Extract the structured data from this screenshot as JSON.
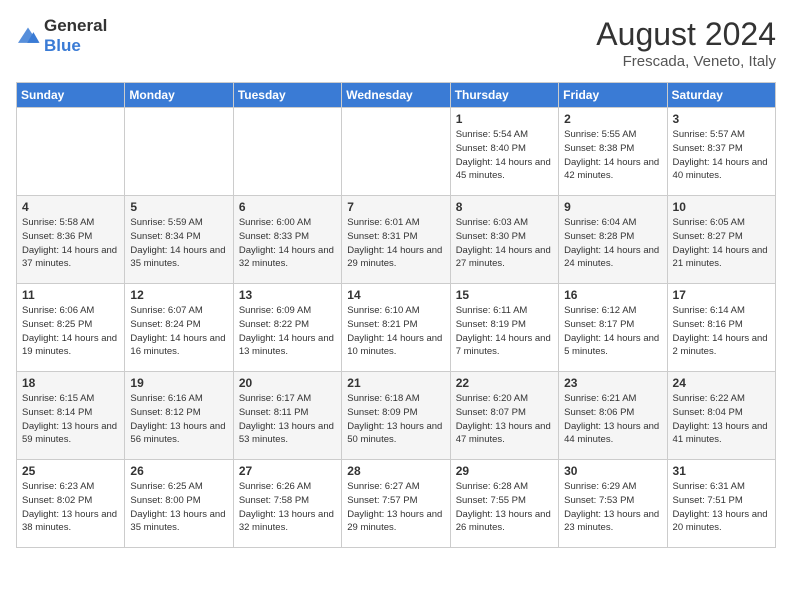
{
  "logo": {
    "general": "General",
    "blue": "Blue"
  },
  "title": {
    "month_year": "August 2024",
    "location": "Frescada, Veneto, Italy"
  },
  "days_of_week": [
    "Sunday",
    "Monday",
    "Tuesday",
    "Wednesday",
    "Thursday",
    "Friday",
    "Saturday"
  ],
  "weeks": [
    [
      {
        "day": "",
        "info": ""
      },
      {
        "day": "",
        "info": ""
      },
      {
        "day": "",
        "info": ""
      },
      {
        "day": "",
        "info": ""
      },
      {
        "day": "1",
        "info": "Sunrise: 5:54 AM\nSunset: 8:40 PM\nDaylight: 14 hours\nand 45 minutes."
      },
      {
        "day": "2",
        "info": "Sunrise: 5:55 AM\nSunset: 8:38 PM\nDaylight: 14 hours\nand 42 minutes."
      },
      {
        "day": "3",
        "info": "Sunrise: 5:57 AM\nSunset: 8:37 PM\nDaylight: 14 hours\nand 40 minutes."
      }
    ],
    [
      {
        "day": "4",
        "info": "Sunrise: 5:58 AM\nSunset: 8:36 PM\nDaylight: 14 hours\nand 37 minutes."
      },
      {
        "day": "5",
        "info": "Sunrise: 5:59 AM\nSunset: 8:34 PM\nDaylight: 14 hours\nand 35 minutes."
      },
      {
        "day": "6",
        "info": "Sunrise: 6:00 AM\nSunset: 8:33 PM\nDaylight: 14 hours\nand 32 minutes."
      },
      {
        "day": "7",
        "info": "Sunrise: 6:01 AM\nSunset: 8:31 PM\nDaylight: 14 hours\nand 29 minutes."
      },
      {
        "day": "8",
        "info": "Sunrise: 6:03 AM\nSunset: 8:30 PM\nDaylight: 14 hours\nand 27 minutes."
      },
      {
        "day": "9",
        "info": "Sunrise: 6:04 AM\nSunset: 8:28 PM\nDaylight: 14 hours\nand 24 minutes."
      },
      {
        "day": "10",
        "info": "Sunrise: 6:05 AM\nSunset: 8:27 PM\nDaylight: 14 hours\nand 21 minutes."
      }
    ],
    [
      {
        "day": "11",
        "info": "Sunrise: 6:06 AM\nSunset: 8:25 PM\nDaylight: 14 hours\nand 19 minutes."
      },
      {
        "day": "12",
        "info": "Sunrise: 6:07 AM\nSunset: 8:24 PM\nDaylight: 14 hours\nand 16 minutes."
      },
      {
        "day": "13",
        "info": "Sunrise: 6:09 AM\nSunset: 8:22 PM\nDaylight: 14 hours\nand 13 minutes."
      },
      {
        "day": "14",
        "info": "Sunrise: 6:10 AM\nSunset: 8:21 PM\nDaylight: 14 hours\nand 10 minutes."
      },
      {
        "day": "15",
        "info": "Sunrise: 6:11 AM\nSunset: 8:19 PM\nDaylight: 14 hours\nand 7 minutes."
      },
      {
        "day": "16",
        "info": "Sunrise: 6:12 AM\nSunset: 8:17 PM\nDaylight: 14 hours\nand 5 minutes."
      },
      {
        "day": "17",
        "info": "Sunrise: 6:14 AM\nSunset: 8:16 PM\nDaylight: 14 hours\nand 2 minutes."
      }
    ],
    [
      {
        "day": "18",
        "info": "Sunrise: 6:15 AM\nSunset: 8:14 PM\nDaylight: 13 hours\nand 59 minutes."
      },
      {
        "day": "19",
        "info": "Sunrise: 6:16 AM\nSunset: 8:12 PM\nDaylight: 13 hours\nand 56 minutes."
      },
      {
        "day": "20",
        "info": "Sunrise: 6:17 AM\nSunset: 8:11 PM\nDaylight: 13 hours\nand 53 minutes."
      },
      {
        "day": "21",
        "info": "Sunrise: 6:18 AM\nSunset: 8:09 PM\nDaylight: 13 hours\nand 50 minutes."
      },
      {
        "day": "22",
        "info": "Sunrise: 6:20 AM\nSunset: 8:07 PM\nDaylight: 13 hours\nand 47 minutes."
      },
      {
        "day": "23",
        "info": "Sunrise: 6:21 AM\nSunset: 8:06 PM\nDaylight: 13 hours\nand 44 minutes."
      },
      {
        "day": "24",
        "info": "Sunrise: 6:22 AM\nSunset: 8:04 PM\nDaylight: 13 hours\nand 41 minutes."
      }
    ],
    [
      {
        "day": "25",
        "info": "Sunrise: 6:23 AM\nSunset: 8:02 PM\nDaylight: 13 hours\nand 38 minutes."
      },
      {
        "day": "26",
        "info": "Sunrise: 6:25 AM\nSunset: 8:00 PM\nDaylight: 13 hours\nand 35 minutes."
      },
      {
        "day": "27",
        "info": "Sunrise: 6:26 AM\nSunset: 7:58 PM\nDaylight: 13 hours\nand 32 minutes."
      },
      {
        "day": "28",
        "info": "Sunrise: 6:27 AM\nSunset: 7:57 PM\nDaylight: 13 hours\nand 29 minutes."
      },
      {
        "day": "29",
        "info": "Sunrise: 6:28 AM\nSunset: 7:55 PM\nDaylight: 13 hours\nand 26 minutes."
      },
      {
        "day": "30",
        "info": "Sunrise: 6:29 AM\nSunset: 7:53 PM\nDaylight: 13 hours\nand 23 minutes."
      },
      {
        "day": "31",
        "info": "Sunrise: 6:31 AM\nSunset: 7:51 PM\nDaylight: 13 hours\nand 20 minutes."
      }
    ]
  ]
}
